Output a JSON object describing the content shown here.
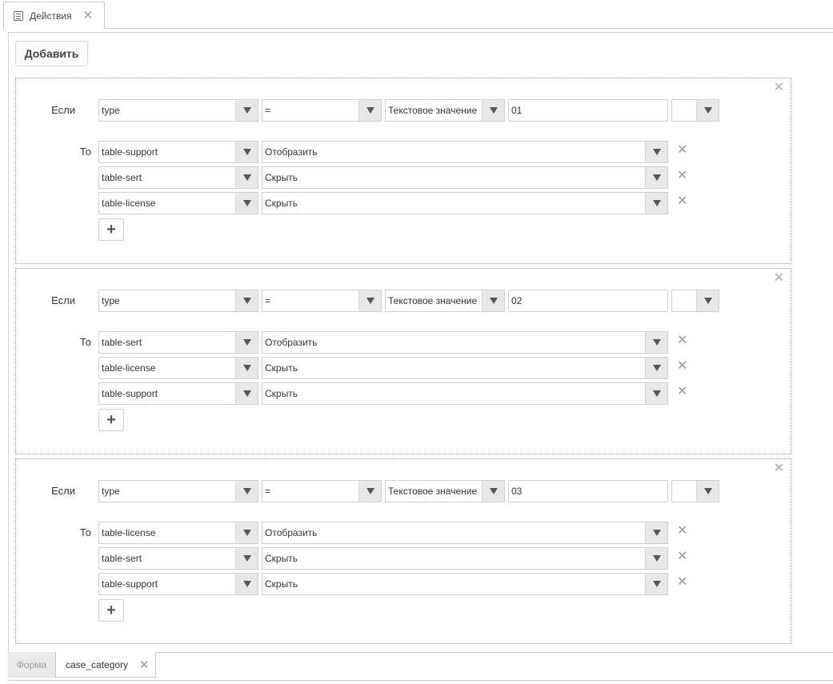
{
  "tab": {
    "label": "Действия",
    "close": "✕"
  },
  "toolbar": {
    "add_label": "Добавить"
  },
  "labels": {
    "if": "Если",
    "then": "То",
    "plus": "+",
    "close": "✕"
  },
  "rules": [
    {
      "condition": {
        "field": "type",
        "operator": "=",
        "value_type": "Текстовое значение",
        "value": "01",
        "extra": ""
      },
      "actions": [
        {
          "target": "table-support",
          "action": "Отобразить"
        },
        {
          "target": "table-sert",
          "action": "Скрыть"
        },
        {
          "target": "table-license",
          "action": "Скрыть"
        }
      ]
    },
    {
      "condition": {
        "field": "type",
        "operator": "=",
        "value_type": "Текстовое значение",
        "value": "02",
        "extra": ""
      },
      "actions": [
        {
          "target": "table-sert",
          "action": "Отобразить"
        },
        {
          "target": "table-license",
          "action": "Скрыть"
        },
        {
          "target": "table-support",
          "action": "Скрыть"
        }
      ]
    },
    {
      "condition": {
        "field": "type",
        "operator": "=",
        "value_type": "Текстовое значение",
        "value": "03",
        "extra": ""
      },
      "actions": [
        {
          "target": "table-license",
          "action": "Отобразить"
        },
        {
          "target": "table-sert",
          "action": "Скрыть"
        },
        {
          "target": "table-support",
          "action": "Скрыть"
        }
      ]
    }
  ],
  "bottom_tabs": {
    "form_label": "Форма",
    "active_label": "case_category",
    "close": "✕"
  }
}
